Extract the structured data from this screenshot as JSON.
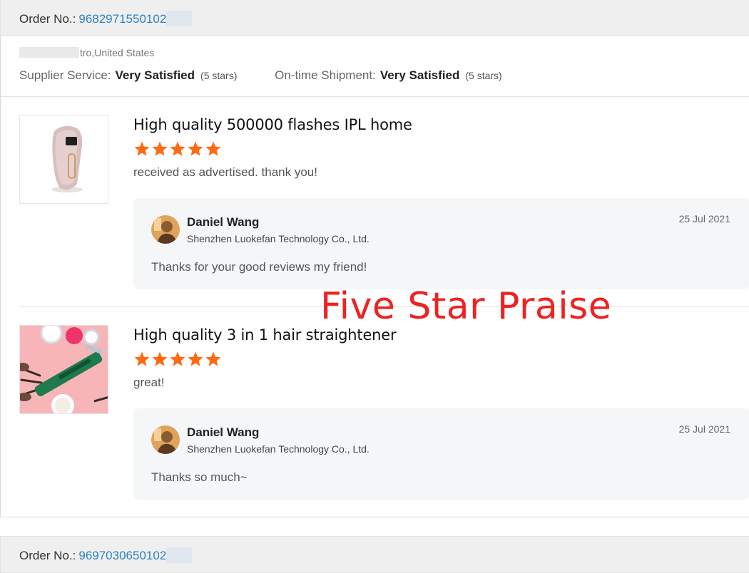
{
  "orders": [
    {
      "label": "Order No.:",
      "number": "9682971550102"
    },
    {
      "label": "Order No.:",
      "number": "9697030650102"
    }
  ],
  "buyer": {
    "location": "tro,United States"
  },
  "ratings": [
    {
      "label": "Supplier Service:",
      "value": "Very Satisfied",
      "stars": "(5 stars)"
    },
    {
      "label": "On-time Shipment:",
      "value": "Very Satisfied",
      "stars": "(5 stars)"
    }
  ],
  "products": [
    {
      "title": "High quality 500000 flashes IPL home",
      "rating": 5,
      "comment": "received as advertised. thank you!",
      "reply": {
        "name": "Daniel Wang",
        "company": "Shenzhen Luokefan Technology Co., Ltd.",
        "date": "25 Jul 2021",
        "text": "Thanks for your good reviews my friend!"
      }
    },
    {
      "title": "High quality 3 in 1 hair straightener",
      "rating": 5,
      "comment": "great!",
      "reply": {
        "name": "Daniel Wang",
        "company": "Shenzhen Luokefan Technology Co., Ltd.",
        "date": "25 Jul 2021",
        "text": "Thanks so much~"
      }
    }
  ],
  "overlay": {
    "text": "Five Star Praise",
    "color": "#ee2222"
  },
  "colors": {
    "link": "#2d82c4",
    "star": "#ff6a13",
    "reply_bg": "#f5f6f8"
  }
}
